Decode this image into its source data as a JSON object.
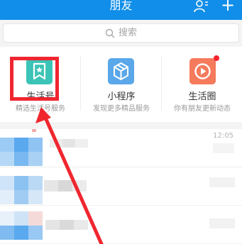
{
  "header": {
    "title": "朋友",
    "plus": "+"
  },
  "search": {
    "placeholder": "搜索"
  },
  "apps": [
    {
      "label": "生活号",
      "sub": "精选生活号服务",
      "icon": "bookmark-star-icon",
      "color": "#3cc4b6"
    },
    {
      "label": "小程序",
      "sub": "发现更多精品服务",
      "icon": "mini-program-icon",
      "color": "#5aa7e9"
    },
    {
      "label": "生活圈",
      "sub": "你有朋友更新动态",
      "icon": "play-circle-icon",
      "color": "#f67a5c",
      "badge": true
    }
  ],
  "list": {
    "time_1": "12:05"
  },
  "colors": {
    "accent": "#108ee9",
    "highlight": "#f0262f",
    "badge": "#f5222d"
  }
}
